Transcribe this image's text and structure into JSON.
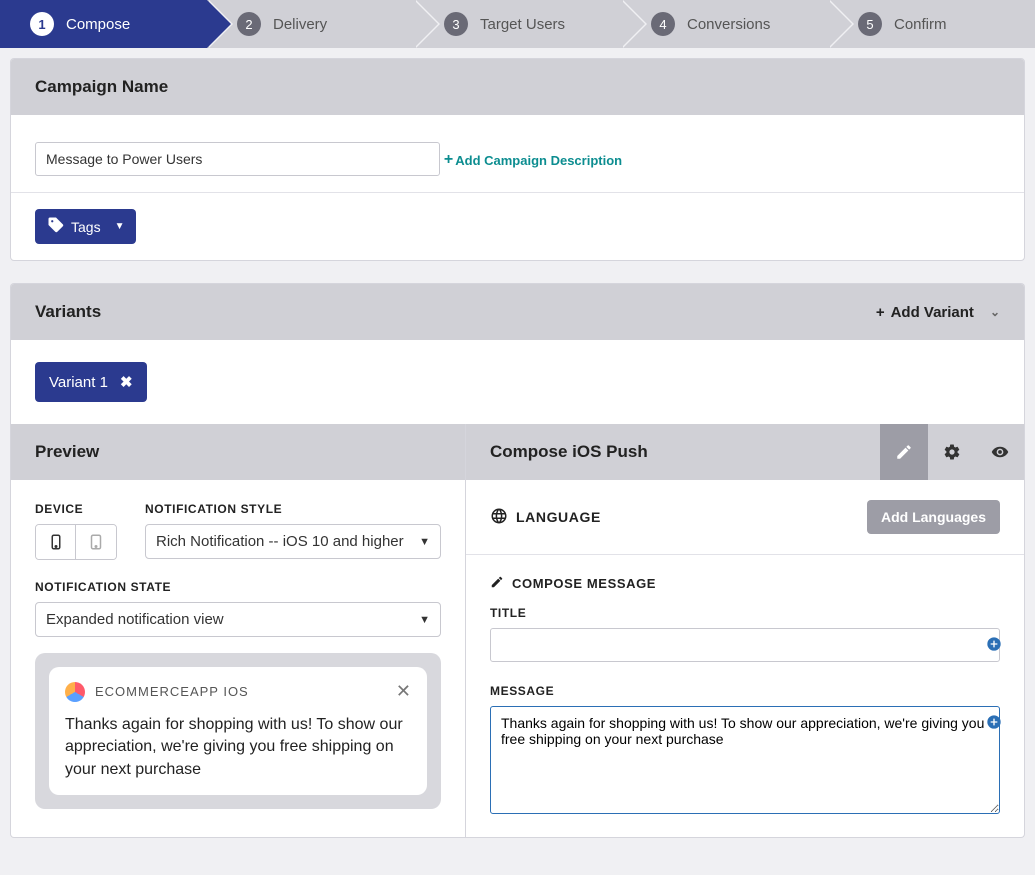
{
  "stepper": [
    {
      "num": "1",
      "label": "Compose"
    },
    {
      "num": "2",
      "label": "Delivery"
    },
    {
      "num": "3",
      "label": "Target Users"
    },
    {
      "num": "4",
      "label": "Conversions"
    },
    {
      "num": "5",
      "label": "Confirm"
    }
  ],
  "campaign": {
    "header": "Campaign Name",
    "name_value": "Message to Power Users",
    "add_desc": "Add Campaign Description",
    "tags_label": "Tags"
  },
  "variants": {
    "header": "Variants",
    "add_label": "Add Variant",
    "chip": "Variant 1"
  },
  "preview": {
    "header": "Preview",
    "device_label": "DEVICE",
    "style_label": "NOTIFICATION STYLE",
    "style_value": "Rich Notification -- iOS 10 and higher",
    "state_label": "NOTIFICATION STATE",
    "state_value": "Expanded notification view",
    "notif_app": "ECOMMERCEAPP IOS",
    "notif_body": "Thanks again for shopping with us! To show our appreciation, we're giving you free shipping on your next purchase"
  },
  "compose": {
    "header": "Compose iOS Push",
    "language_label": "LANGUAGE",
    "add_languages": "Add Languages",
    "compose_msg_label": "COMPOSE MESSAGE",
    "title_label": "TITLE",
    "title_value": "",
    "message_label": "MESSAGE",
    "message_value": "Thanks again for shopping with us! To show our appreciation, we're giving you free shipping on your next purchase"
  }
}
